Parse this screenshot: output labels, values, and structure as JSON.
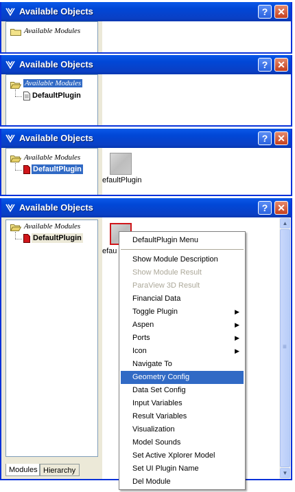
{
  "windows": [
    {
      "title": "Available Objects",
      "tree": {
        "root_label": "Available Modules",
        "root_selected": false,
        "child_label": ""
      },
      "tile_label": ""
    },
    {
      "title": "Available Objects",
      "tree": {
        "root_label": "Available Modules",
        "root_selected": true,
        "child_label": "DefaultPlugin"
      },
      "tile_label": ""
    },
    {
      "title": "Available Objects",
      "tree": {
        "root_label": "Available Modules",
        "root_selected": false,
        "child_label": "DefaultPlugin"
      },
      "tile_label": "efaultPlugin"
    },
    {
      "title": "Available Objects",
      "tree": {
        "root_label": "Available Modules",
        "root_selected": false,
        "child_label": "DefaultPlugin"
      },
      "tile_label": "efau",
      "tabs": [
        "Modules",
        "Hierarchy"
      ]
    }
  ],
  "title_buttons": {
    "help": "?",
    "close": "✕"
  },
  "scrollbar": {
    "up": "▲",
    "down": "▼",
    "grip": "≡"
  },
  "context_menu": {
    "header": "DefaultPlugin Menu",
    "items": [
      {
        "label": "Show Module Description",
        "disabled": false,
        "submenu": false
      },
      {
        "label": "Show Module Result",
        "disabled": true,
        "submenu": false
      },
      {
        "label": "ParaView 3D Result",
        "disabled": true,
        "submenu": false
      },
      {
        "label": "Financial Data",
        "disabled": false,
        "submenu": false
      },
      {
        "label": "Toggle Plugin",
        "disabled": false,
        "submenu": true
      },
      {
        "label": "Aspen",
        "disabled": false,
        "submenu": true
      },
      {
        "label": "Ports",
        "disabled": false,
        "submenu": true
      },
      {
        "label": "Icon",
        "disabled": false,
        "submenu": true
      },
      {
        "label": "Navigate To",
        "disabled": false,
        "submenu": false
      },
      {
        "label": "Geometry Config",
        "disabled": false,
        "submenu": false,
        "highlighted": true
      },
      {
        "label": "Data Set Config",
        "disabled": false,
        "submenu": false
      },
      {
        "label": "Input Variables",
        "disabled": false,
        "submenu": false
      },
      {
        "label": "Result Variables",
        "disabled": false,
        "submenu": false
      },
      {
        "label": "Visualization",
        "disabled": false,
        "submenu": false
      },
      {
        "label": "Model Sounds",
        "disabled": false,
        "submenu": false
      },
      {
        "label": "Set Active Xplorer Model",
        "disabled": false,
        "submenu": false
      },
      {
        "label": "Set UI Plugin Name",
        "disabled": false,
        "submenu": false
      },
      {
        "label": "Del Module",
        "disabled": false,
        "submenu": false
      }
    ],
    "submenu_arrow": "▶"
  },
  "colors": {
    "title_blue": "#0a58e8",
    "selection": "#316ac5",
    "face": "#ece9d8",
    "module_red": "#d0161b"
  }
}
